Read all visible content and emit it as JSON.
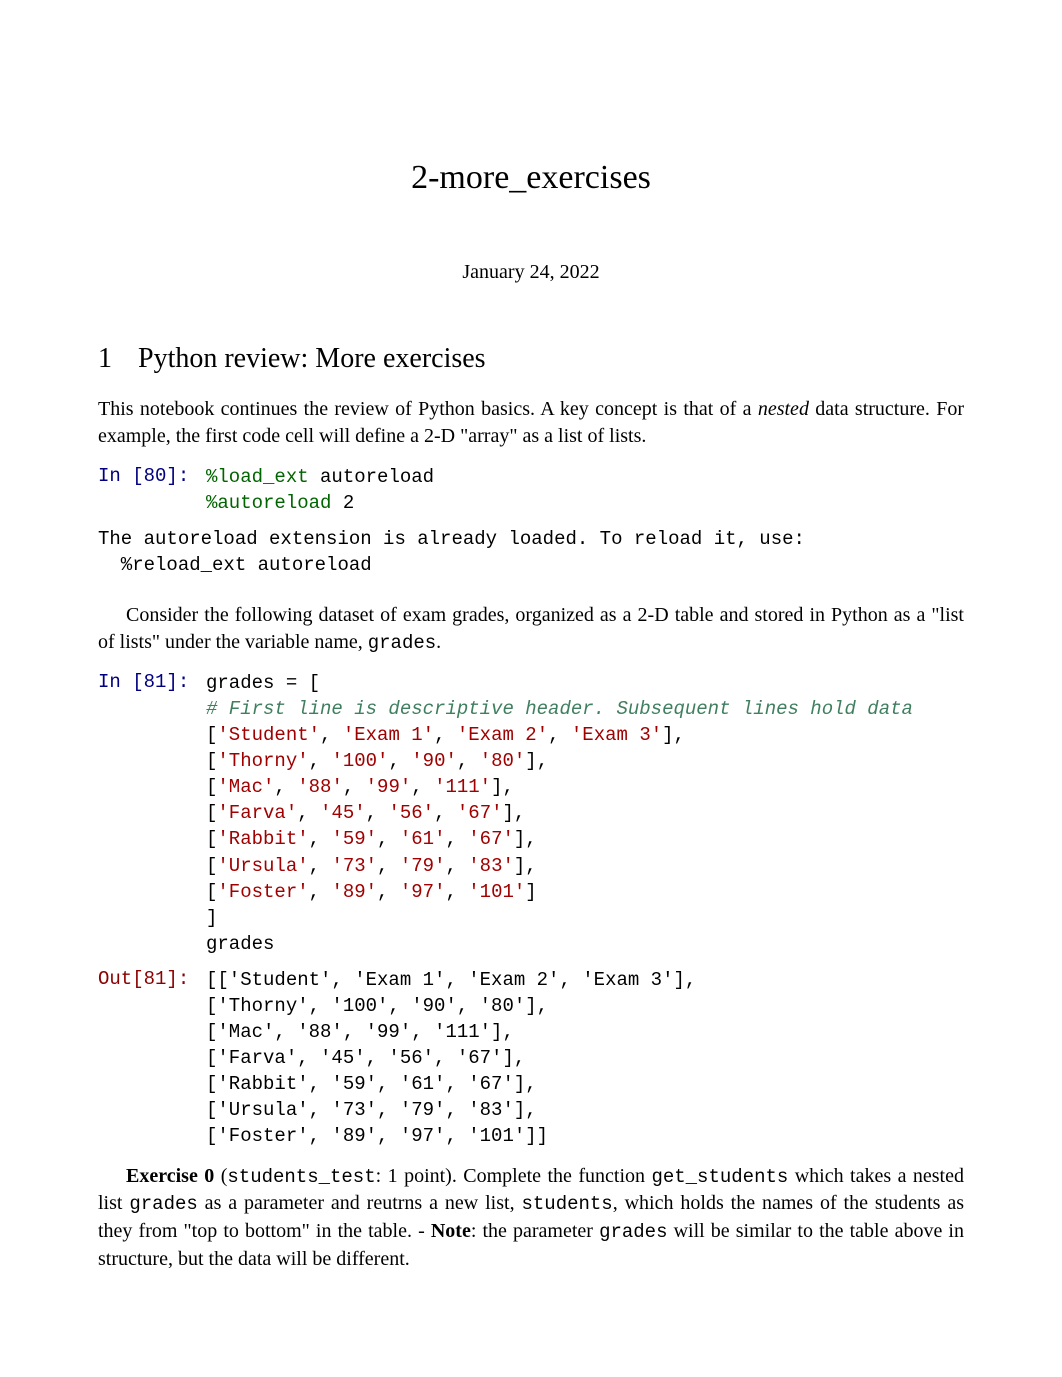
{
  "title": "2-more_exercises",
  "date": "January 24, 2022",
  "section": {
    "number": "1",
    "title": "Python review: More exercises"
  },
  "p1a": "This notebook continues the review of Python basics. A key concept is that of a ",
  "p1b": "nested",
  "p1c": " data structure. For example, the first code cell will define a 2-D \"array\" as a list of lists.",
  "cell80": {
    "prompt": "In [80]:",
    "l1_magic": "%load_ext",
    "l1_arg": " autoreload",
    "l2_magic": "%autoreload",
    "l2_arg": " 2"
  },
  "stdout1_l1": "The autoreload extension is already loaded. To reload it, use:",
  "stdout1_l2": "  %reload_ext autoreload",
  "p2a": "Consider the following dataset of exam grades, organized as a 2-D table and stored in Python as a \"list of lists\" under the variable name, ",
  "p2b": "grades",
  "p2c": ".",
  "cell81": {
    "prompt": "In [81]:",
    "l1": "grades = [",
    "l2": "    # First line is descriptive header. Subsequent lines hold data",
    "l3_a": "    [",
    "l3_s1": "'Student'",
    "l3_c1": ", ",
    "l3_s2": "'Exam 1'",
    "l3_c2": ", ",
    "l3_s3": "'Exam 2'",
    "l3_c3": ", ",
    "l3_s4": "'Exam 3'",
    "l3_b": "],",
    "l4_a": "    [",
    "l4_s1": "'Thorny'",
    "l4_c1": ", ",
    "l4_s2": "'100'",
    "l4_c2": ", ",
    "l4_s3": "'90'",
    "l4_c3": ", ",
    "l4_s4": "'80'",
    "l4_b": "],",
    "l5_a": "    [",
    "l5_s1": "'Mac'",
    "l5_c1": ", ",
    "l5_s2": "'88'",
    "l5_c2": ", ",
    "l5_s3": "'99'",
    "l5_c3": ", ",
    "l5_s4": "'111'",
    "l5_b": "],",
    "l6_a": "    [",
    "l6_s1": "'Farva'",
    "l6_c1": ", ",
    "l6_s2": "'45'",
    "l6_c2": ", ",
    "l6_s3": "'56'",
    "l6_c3": ", ",
    "l6_s4": "'67'",
    "l6_b": "],",
    "l7_a": "    [",
    "l7_s1": "'Rabbit'",
    "l7_c1": ", ",
    "l7_s2": "'59'",
    "l7_c2": ", ",
    "l7_s3": "'61'",
    "l7_c3": ", ",
    "l7_s4": "'67'",
    "l7_b": "],",
    "l8_a": "    [",
    "l8_s1": "'Ursula'",
    "l8_c1": ", ",
    "l8_s2": "'73'",
    "l8_c2": ", ",
    "l8_s3": "'79'",
    "l8_c3": ", ",
    "l8_s4": "'83'",
    "l8_b": "],",
    "l9_a": "    [",
    "l9_s1": "'Foster'",
    "l9_c1": ", ",
    "l9_s2": "'89'",
    "l9_c2": ", ",
    "l9_s3": "'97'",
    "l9_c3": ", ",
    "l9_s4": "'101'",
    "l9_b": "]",
    "l10": "]",
    "l11": "",
    "l12": "grades"
  },
  "out81": {
    "prompt": "Out[81]:",
    "l1": "[['Student', 'Exam 1', 'Exam 2', 'Exam 3'],",
    "l2": " ['Thorny', '100', '90', '80'],",
    "l3": " ['Mac', '88', '99', '111'],",
    "l4": " ['Farva', '45', '56', '67'],",
    "l5": " ['Rabbit', '59', '61', '67'],",
    "l6": " ['Ursula', '73', '79', '83'],",
    "l7": " ['Foster', '89', '97', '101']]"
  },
  "p3a": "Exercise 0",
  "p3b": " (",
  "p3c": "students_test",
  "p3d": ": 1 point). Complete the function ",
  "p3e": "get_students",
  "p3f": " which takes a nested list ",
  "p3g": "grades",
  "p3h": " as a parameter and reutrns a new list, ",
  "p3i": "students",
  "p3j": ", which holds the names of the students as they from \"top to bottom\" in the table. - ",
  "p3k": "Note",
  "p3l": ": the parameter ",
  "p3m": "grades",
  "p3n": " will be similar to the table above in structure, but the data will be different.",
  "chart_data": {
    "type": "table",
    "title": "grades (2-D list of exam scores)",
    "columns": [
      "Student",
      "Exam 1",
      "Exam 2",
      "Exam 3"
    ],
    "rows": [
      {
        "Student": "Thorny",
        "Exam 1": 100,
        "Exam 2": 90,
        "Exam 3": 80
      },
      {
        "Student": "Mac",
        "Exam 1": 88,
        "Exam 2": 99,
        "Exam 3": 111
      },
      {
        "Student": "Farva",
        "Exam 1": 45,
        "Exam 2": 56,
        "Exam 3": 67
      },
      {
        "Student": "Rabbit",
        "Exam 1": 59,
        "Exam 2": 61,
        "Exam 3": 67
      },
      {
        "Student": "Ursula",
        "Exam 1": 73,
        "Exam 2": 79,
        "Exam 3": 83
      },
      {
        "Student": "Foster",
        "Exam 1": 89,
        "Exam 2": 97,
        "Exam 3": 101
      }
    ]
  }
}
